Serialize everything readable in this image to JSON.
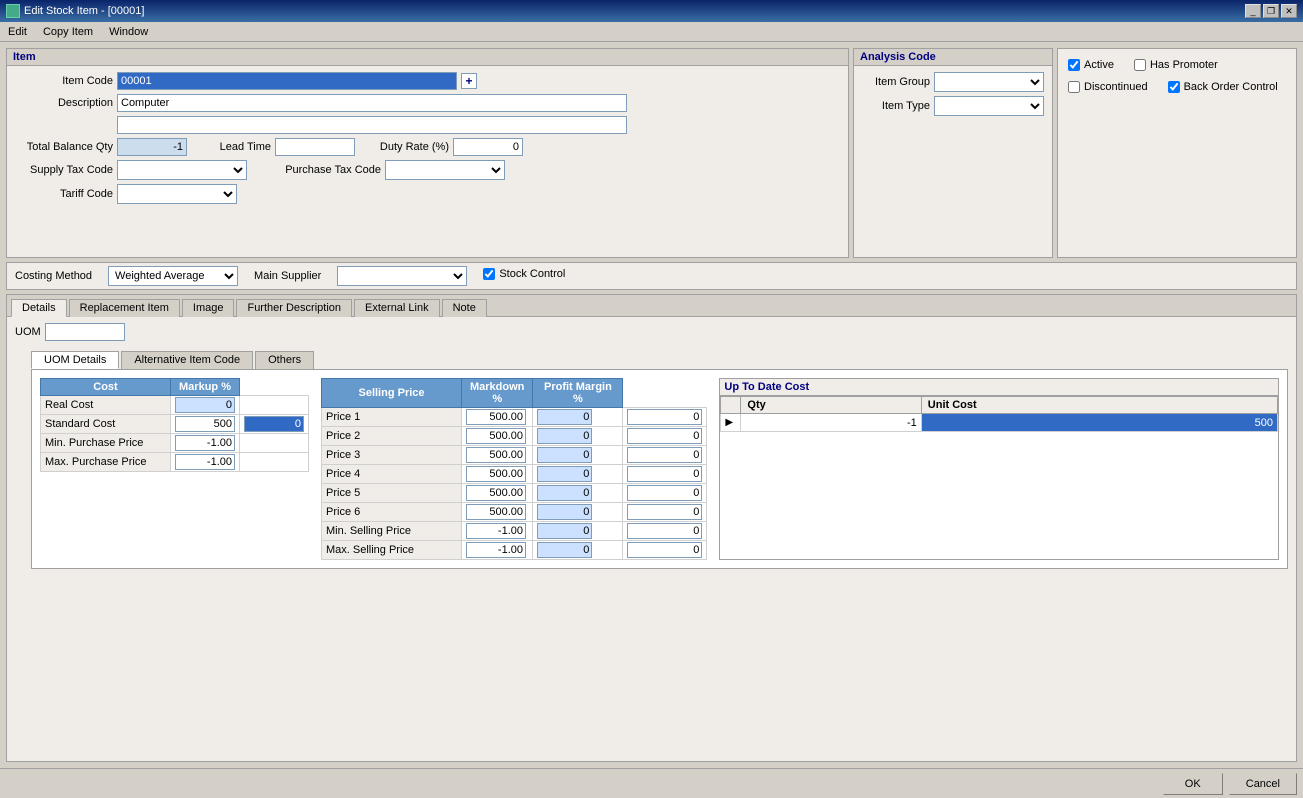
{
  "titleBar": {
    "title": "Edit Stock Item - [00001]",
    "minimize": "_",
    "restore": "❐",
    "close": "✕"
  },
  "menuBar": {
    "items": [
      "Edit",
      "Copy Item",
      "Window"
    ]
  },
  "itemPanel": {
    "title": "Item",
    "itemCodeLabel": "Item Code",
    "itemCodeValue": "00001",
    "descriptionLabel": "Description",
    "descriptionValue": "Computer",
    "descriptionExtra": "",
    "totalBalanceQtyLabel": "Total Balance Qty",
    "totalBalanceQtyValue": "-1",
    "leadTimeLabel": "Lead Time",
    "leadTimeValue": "",
    "dutyRateLabel": "Duty Rate (%)",
    "dutyRateValue": "0",
    "supplyTaxCodeLabel": "Supply Tax Code",
    "supplyTaxCodeValue": "",
    "purchaseTaxCodeLabel": "Purchase Tax Code",
    "purchaseTaxCodeValue": "",
    "tariffCodeLabel": "Tariff Code",
    "tariffCodeValue": ""
  },
  "analysisPanel": {
    "title": "Analysis Code",
    "itemGroupLabel": "Item Group",
    "itemGroupValue": "",
    "itemTypeLabel": "Item Type",
    "itemTypeValue": ""
  },
  "flagsPanel": {
    "activeLabel": "Active",
    "activeChecked": true,
    "hasPromoterLabel": "Has Promoter",
    "hasPromoterChecked": false,
    "discontinuedLabel": "Discontinued",
    "discontinuedChecked": false,
    "backOrderControlLabel": "Back Order Control",
    "backOrderControlChecked": true
  },
  "costingRow": {
    "costingMethodLabel": "Costing Method",
    "costingMethodValue": "Weighted Average",
    "mainSupplierLabel": "Main Supplier",
    "mainSupplierValue": "",
    "stockControlLabel": "Stock Control",
    "stockControlChecked": true
  },
  "tabs": {
    "items": [
      "Details",
      "Replacement Item",
      "Image",
      "Further Description",
      "External Link",
      "Note"
    ],
    "activeTab": "Details"
  },
  "detailsTab": {
    "uomLabel": "UOM",
    "uomValue": "",
    "innerTabs": [
      "UOM Details",
      "Alternative Item Code",
      "Others"
    ],
    "activeInnerTab": "UOM Details"
  },
  "costTable": {
    "headers": [
      "Cost",
      "Markup %"
    ],
    "rows": [
      {
        "label": "Real Cost",
        "cost": "0",
        "markup": ""
      },
      {
        "label": "Standard Cost",
        "cost": "500",
        "markup": "0"
      },
      {
        "label": "Min. Purchase Price",
        "cost": "-1.00",
        "markup": ""
      },
      {
        "label": "Max. Purchase Price",
        "cost": "-1.00",
        "markup": ""
      }
    ]
  },
  "sellingTable": {
    "headers": [
      "Selling Price",
      "Markdown %",
      "Profit Margin %"
    ],
    "rows": [
      {
        "label": "Price 1",
        "price": "500.00",
        "markdown": "0",
        "margin": "0"
      },
      {
        "label": "Price 2",
        "price": "500.00",
        "markdown": "0",
        "margin": "0"
      },
      {
        "label": "Price 3",
        "price": "500.00",
        "markdown": "0",
        "margin": "0"
      },
      {
        "label": "Price 4",
        "price": "500.00",
        "markdown": "0",
        "margin": "0"
      },
      {
        "label": "Price 5",
        "price": "500.00",
        "markdown": "0",
        "margin": "0"
      },
      {
        "label": "Price 6",
        "price": "500.00",
        "markdown": "0",
        "margin": "0"
      },
      {
        "label": "Min. Selling Price",
        "price": "-1.00",
        "markdown": "0",
        "margin": "0"
      },
      {
        "label": "Max. Selling Price",
        "price": "-1.00",
        "markdown": "0",
        "margin": "0"
      }
    ]
  },
  "upToDateCost": {
    "title": "Up To Date Cost",
    "qtyHeader": "Qty",
    "unitCostHeader": "Unit Cost",
    "rows": [
      {
        "arrow": "▶",
        "qty": "-1",
        "unitCost": "500"
      }
    ]
  },
  "bottomBar": {
    "okLabel": "OK",
    "cancelLabel": "Cancel"
  }
}
